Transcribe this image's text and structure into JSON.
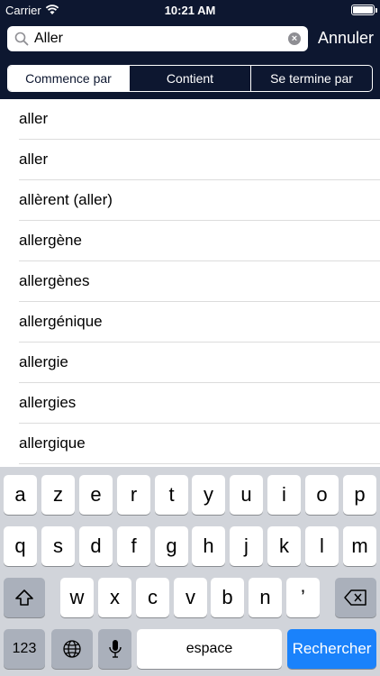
{
  "status": {
    "carrier": "Carrier",
    "time": "10:21 AM",
    "battery_level": 1.0
  },
  "search": {
    "value": "Aller",
    "clear_icon": "clear-icon",
    "cancel_label": "Annuler"
  },
  "filters": [
    {
      "label": "Commence par",
      "selected": true
    },
    {
      "label": "Contient",
      "selected": false
    },
    {
      "label": "Se termine par",
      "selected": false
    }
  ],
  "results": [
    "aller",
    "aller",
    "allèrent (aller)",
    "allergène",
    "allergènes",
    "allergénique",
    "allergie",
    "allergies",
    "allergique"
  ],
  "keyboard": {
    "row1": [
      "a",
      "z",
      "e",
      "r",
      "t",
      "y",
      "u",
      "i",
      "o",
      "p"
    ],
    "row2": [
      "q",
      "s",
      "d",
      "f",
      "g",
      "h",
      "j",
      "k",
      "l",
      "m"
    ],
    "row3": [
      "w",
      "x",
      "c",
      "v",
      "b",
      "n",
      "’"
    ],
    "numbers_label": "123",
    "space_label": "espace",
    "search_label": "Rechercher"
  },
  "colors": {
    "header_bg": "#0d1730",
    "accent_blue": "#1a82fb",
    "keyboard_bg": "#d1d4da"
  }
}
